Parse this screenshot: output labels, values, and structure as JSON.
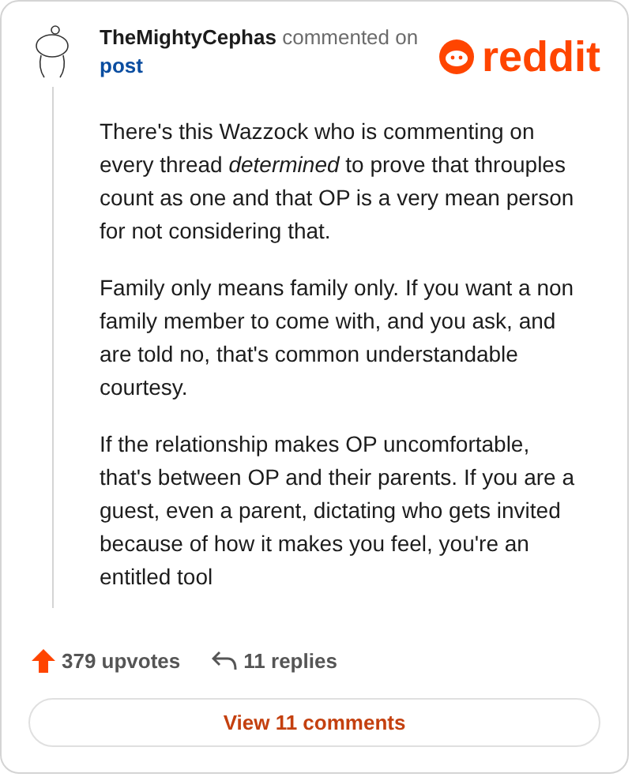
{
  "comment": {
    "author": "TheMightyCephas",
    "action": "commented on",
    "target": "post"
  },
  "brand": {
    "name": "reddit"
  },
  "paragraphs": [
    "There's this Wazzock who is commenting on every thread *determined* to prove that throuples count as one and that OP is a very mean person for not considering that.",
    "Family only means family only. If you want a non family member to come with, and you ask, and are told no, that's common understandable courtesy.",
    "If the relationship makes OP uncomfortable, that's between OP and their parents. If you are a guest, even a parent, dictating who gets invited because of how it makes you feel, you're an entitled tool"
  ],
  "stats": {
    "upvotes": "379 upvotes",
    "replies": "11 replies"
  },
  "button": {
    "label": "View 11 comments"
  }
}
